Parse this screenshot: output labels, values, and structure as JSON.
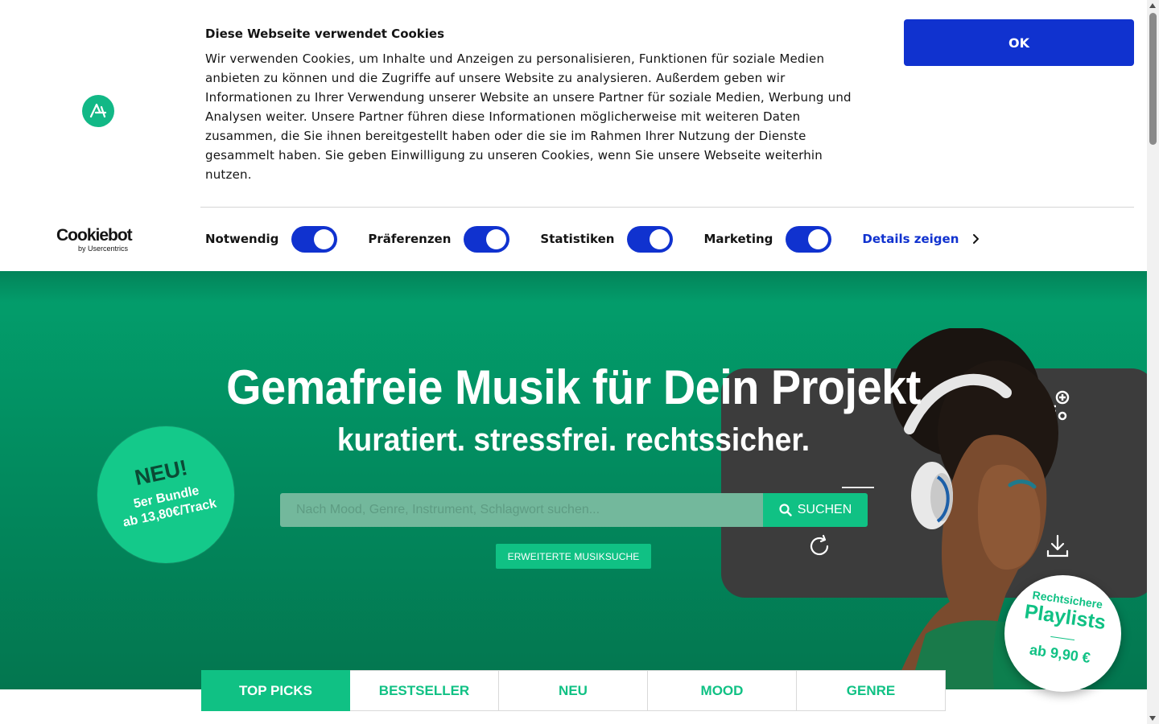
{
  "cookie": {
    "title": "Diese Webseite verwendet Cookies",
    "text": "Wir verwenden Cookies, um Inhalte und Anzeigen zu personalisieren, Funktionen für soziale Medien anbieten zu können und die Zugriffe auf unsere Website zu analysieren. Außerdem geben wir Informationen zu Ihrer Verwendung unserer Website an unsere Partner für soziale Medien, Werbung und Analysen weiter. Unsere Partner führen diese Informationen möglicherweise mit weiteren Daten zusammen, die Sie ihnen bereitgestellt haben oder die sie im Rahmen Ihrer Nutzung der Dienste gesammelt haben. Sie geben Einwilligung zu unseren Cookies, wenn Sie unsere Webseite weiterhin nutzen.",
    "ok_label": "OK",
    "provider_logo": "Cookiebot",
    "provider_sub": "by Usercentrics",
    "categories": [
      {
        "label": "Notwendig",
        "checked": true
      },
      {
        "label": "Präferenzen",
        "checked": true
      },
      {
        "label": "Statistiken",
        "checked": true
      },
      {
        "label": "Marketing",
        "checked": true
      }
    ],
    "details_label": "Details zeigen",
    "accent_color": "#1032cf"
  },
  "hero": {
    "title": "Gemafreie Musik für Dein Projekt",
    "subtitle": "kuratiert. stressfrei. rechtssicher.",
    "badge_new": {
      "line1": "NEU!",
      "line2": "5er Bundle",
      "line3": "ab 13,80€/Track"
    },
    "search": {
      "placeholder": "Nach Mood, Genre, Instrument, Schlagwort suchen...",
      "button_label": "SUCHEN"
    },
    "advanced_search_label": "ERWEITERTE MUSIKSUCHE",
    "badge_playlist": {
      "line1": "Rechtsichere",
      "line2": "Playlists",
      "line3": "ab 9,90 €"
    },
    "brand_color": "#10c184"
  },
  "tabs": [
    {
      "label": "TOP PICKS",
      "active": true
    },
    {
      "label": "BESTSELLER",
      "active": false
    },
    {
      "label": "NEU",
      "active": false
    },
    {
      "label": "MOOD",
      "active": false
    },
    {
      "label": "GENRE",
      "active": false
    }
  ],
  "icons": [
    "site-logo-icon",
    "search-icon",
    "repeat-icon",
    "download-icon",
    "add-to-playlist-icon",
    "chevron-right-icon"
  ]
}
